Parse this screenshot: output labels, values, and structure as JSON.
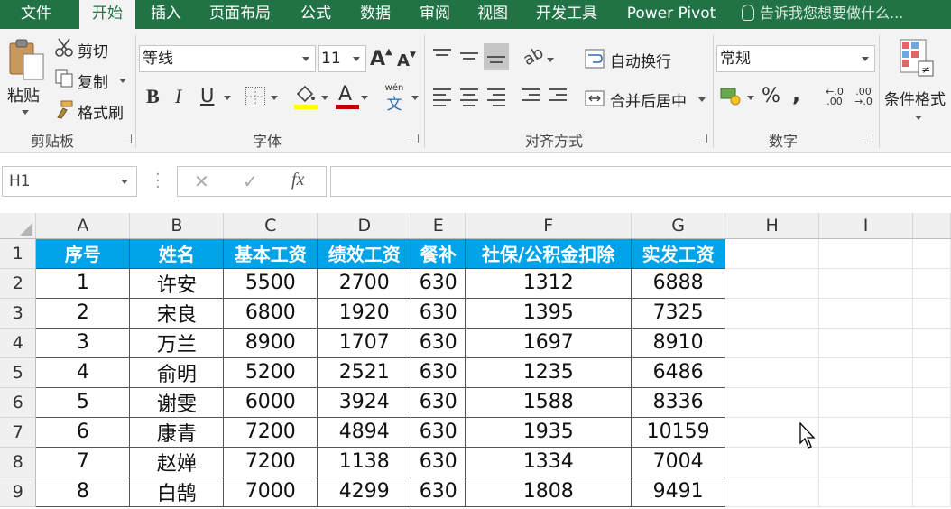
{
  "ribbon_tabs": [
    {
      "label": "文件",
      "active": false
    },
    {
      "label": "开始",
      "active": true
    },
    {
      "label": "插入",
      "active": false
    },
    {
      "label": "页面布局",
      "active": false
    },
    {
      "label": "公式",
      "active": false
    },
    {
      "label": "数据",
      "active": false
    },
    {
      "label": "审阅",
      "active": false
    },
    {
      "label": "视图",
      "active": false
    },
    {
      "label": "开发工具",
      "active": false
    },
    {
      "label": "Power Pivot",
      "active": false
    }
  ],
  "tell_me": "告诉我您想要做什么...",
  "clipboard": {
    "paste": "粘贴",
    "cut": "剪切",
    "copy": "复制",
    "format_painter": "格式刷",
    "group_label": "剪贴板"
  },
  "font": {
    "font_name": "等线",
    "font_size": "11",
    "bold": "B",
    "italic": "I",
    "underline": "U",
    "increase_size": "A",
    "decrease_size": "A",
    "font_color_glyph": "A",
    "phonetic": "wén",
    "phonetic_char": "文",
    "group_label": "字体"
  },
  "alignment": {
    "wrap_text": "自动换行",
    "merge_center": "合并后居中",
    "group_label": "对齐方式"
  },
  "number": {
    "format": "常规",
    "percent": "%",
    "comma": ",",
    "inc_decimal": "←.0 .00",
    "dec_decimal": ".00 →.0",
    "group_label": "数字"
  },
  "styles": {
    "conditional_format": "条件格式"
  },
  "formula_bar": {
    "name_box": "H1",
    "cancel": "✕",
    "enter": "✓",
    "fx": "fx",
    "formula": ""
  },
  "sheet": {
    "columns": [
      "A",
      "B",
      "C",
      "D",
      "E",
      "F",
      "G",
      "H",
      "I"
    ],
    "row_numbers": [
      "1",
      "2",
      "3",
      "4",
      "5",
      "6",
      "7",
      "8",
      "9"
    ],
    "header_row": [
      "序号",
      "姓名",
      "基本工资",
      "绩效工资",
      "餐补",
      "社保/公积金扣除",
      "实发工资"
    ],
    "header_color": "#00a2e8",
    "rows": [
      [
        "1",
        "许安",
        "5500",
        "2700",
        "630",
        "1312",
        "6888"
      ],
      [
        "2",
        "宋良",
        "6800",
        "1920",
        "630",
        "1395",
        "7325"
      ],
      [
        "3",
        "万兰",
        "8900",
        "1707",
        "630",
        "1697",
        "8910"
      ],
      [
        "4",
        "俞明",
        "5200",
        "2521",
        "630",
        "1235",
        "6486"
      ],
      [
        "5",
        "谢雯",
        "6000",
        "3924",
        "630",
        "1588",
        "8336"
      ],
      [
        "6",
        "康青",
        "7200",
        "4894",
        "630",
        "1935",
        "10159"
      ],
      [
        "7",
        "赵婵",
        "7200",
        "1138",
        "630",
        "1334",
        "7004"
      ],
      [
        "8",
        "白鹄",
        "7000",
        "4299",
        "630",
        "1808",
        "9491"
      ]
    ]
  },
  "colors": {
    "ribbon_green": "#217346",
    "ribbon_bg": "#f3f3f3"
  }
}
